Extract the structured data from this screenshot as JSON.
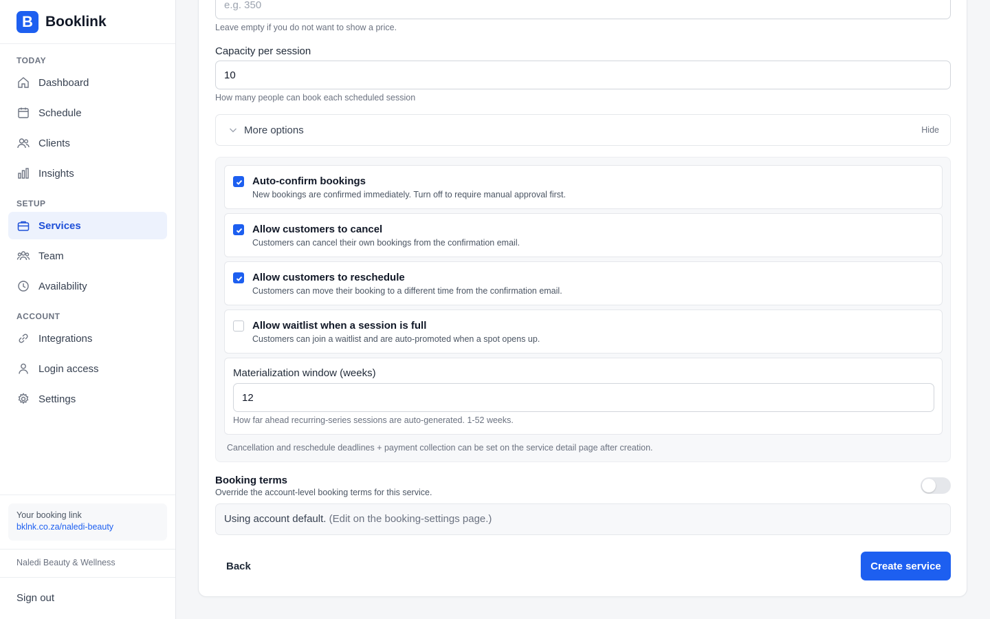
{
  "brand": {
    "logo_letter": "B",
    "name": "Booklink"
  },
  "colors": {
    "accent": "#1d5ff0",
    "active_bg": "#edf2fd"
  },
  "sidebar": {
    "sections": [
      {
        "label": "TODAY"
      },
      {
        "label": "SETUP"
      },
      {
        "label": "ACCOUNT"
      }
    ],
    "items": [
      {
        "label": "Dashboard",
        "icon": "home-icon"
      },
      {
        "label": "Schedule",
        "icon": "calendar-icon"
      },
      {
        "label": "Clients",
        "icon": "users-icon"
      },
      {
        "label": "Insights",
        "icon": "bar-chart-icon"
      },
      {
        "label": "Services",
        "icon": "briefcase-icon",
        "active": true
      },
      {
        "label": "Team",
        "icon": "team-icon"
      },
      {
        "label": "Availability",
        "icon": "clock-icon"
      },
      {
        "label": "Integrations",
        "icon": "link-icon"
      },
      {
        "label": "Login access",
        "icon": "user-icon"
      },
      {
        "label": "Settings",
        "icon": "gear-icon"
      }
    ],
    "booking_link_label": "Your booking link",
    "booking_link_url": "bklnk.co.za/naledi-beauty",
    "business_name": "Naledi Beauty & Wellness",
    "sign_out": "Sign out"
  },
  "form": {
    "price": {
      "placeholder": "e.g. 350",
      "help": "Leave empty if you do not want to show a price."
    },
    "capacity": {
      "label": "Capacity per session",
      "value": "10",
      "help": "How many people can book each scheduled session"
    },
    "more_options": {
      "label": "More options",
      "toggle_label": "Hide"
    },
    "options": [
      {
        "title": "Auto-confirm bookings",
        "desc": "New bookings are confirmed immediately. Turn off to require manual approval first.",
        "checked": true
      },
      {
        "title": "Allow customers to cancel",
        "desc": "Customers can cancel their own bookings from the confirmation email.",
        "checked": true
      },
      {
        "title": "Allow customers to reschedule",
        "desc": "Customers can move their booking to a different time from the confirmation email.",
        "checked": true
      },
      {
        "title": "Allow waitlist when a session is full",
        "desc": "Customers can join a waitlist and are auto-promoted when a spot opens up.",
        "checked": false
      }
    ],
    "materialization": {
      "label": "Materialization window (weeks)",
      "value": "12",
      "help": "How far ahead recurring-series sessions are auto-generated. 1-52 weeks."
    },
    "options_note": "Cancellation and reschedule deadlines + payment collection can be set on the service detail page after creation.",
    "booking_terms": {
      "title": "Booking terms",
      "desc": "Override the account-level booking terms for this service.",
      "enabled": false,
      "default_text": "Using account default.",
      "default_hint": "(Edit on the booking-settings page.)"
    },
    "back_label": "Back",
    "create_label": "Create service"
  }
}
